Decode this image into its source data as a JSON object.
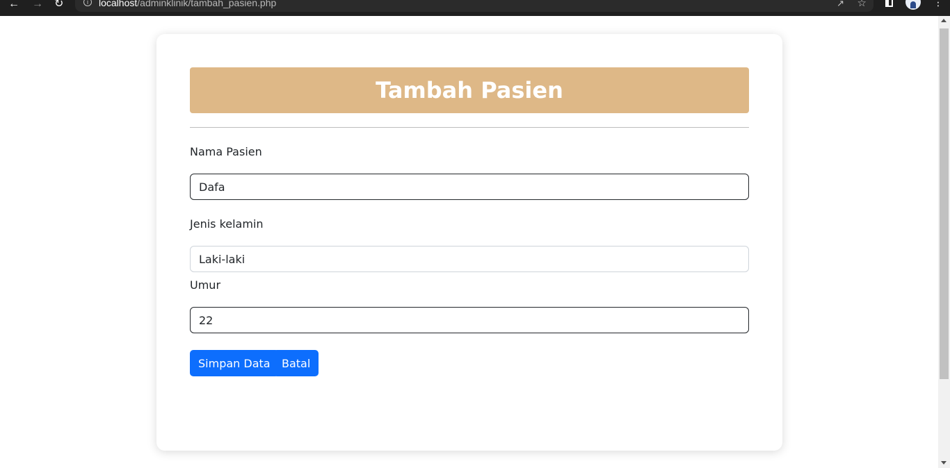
{
  "browser": {
    "url_host": "localhost",
    "url_path": "/adminklinik/tambah_pasien.php",
    "icons": [
      "back-arrow-icon",
      "forward-arrow-icon",
      "reload-icon",
      "info-icon",
      "share-icon",
      "star-icon",
      "side-panel-icon",
      "avatar",
      "menu-icon"
    ]
  },
  "form": {
    "title": "Tambah Pasien",
    "fields": [
      {
        "label": "Nama Pasien",
        "value": "Dafa"
      },
      {
        "label": "Jenis kelamin",
        "value": "Laki-laki"
      },
      {
        "label": "Umur",
        "value": "22"
      }
    ],
    "buttons": {
      "save": "Simpan Data",
      "cancel": "Batal"
    }
  },
  "colors": {
    "banner": "#deb887",
    "primary_button": "#0d6efd",
    "browser_bar": "#1f1f1f"
  }
}
